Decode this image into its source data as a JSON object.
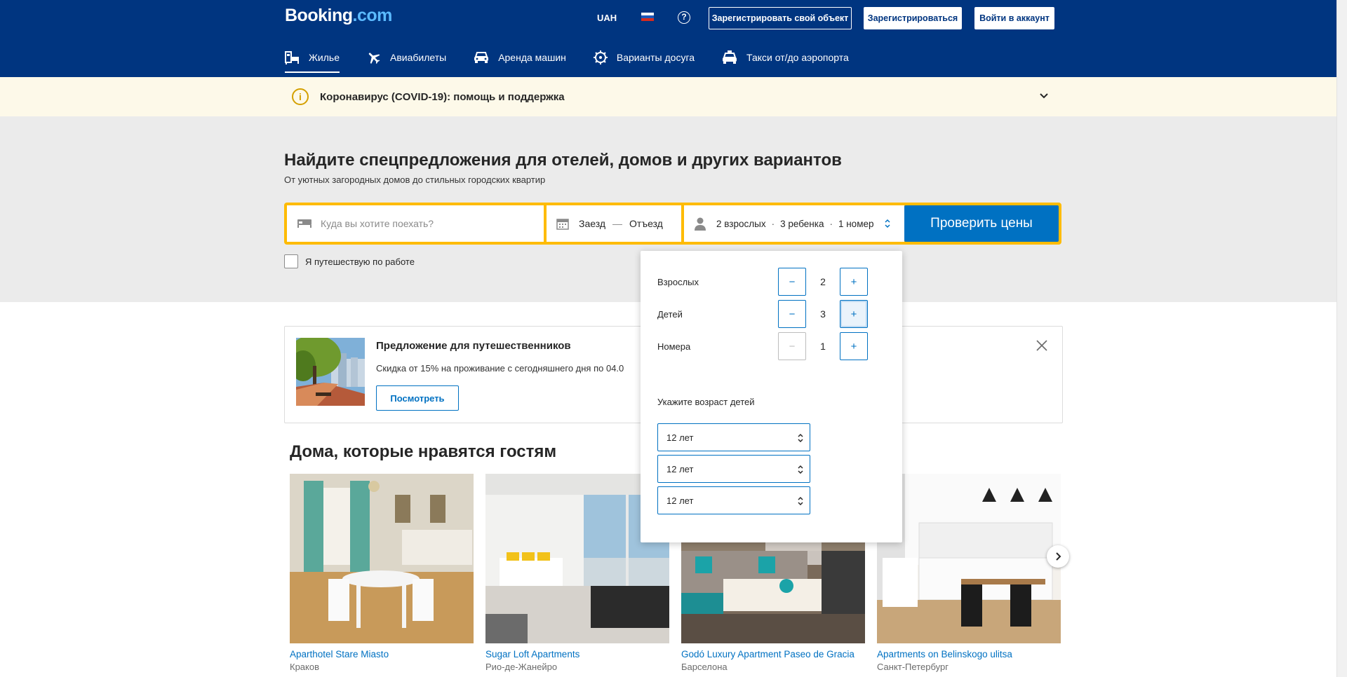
{
  "header": {
    "logo_main": "Booking",
    "logo_suffix": ".com",
    "currency": "UAH",
    "language_flag": "flag-ru-icon",
    "help_icon": "?",
    "list_property_label": "Зарегистрировать свой объект",
    "register_label": "Зарегистрироваться",
    "login_label": "Войти в аккаунт",
    "colors": {
      "brand_blue": "#003580",
      "accent_blue": "#0071c2",
      "search_yellow": "#febb02"
    }
  },
  "nav": {
    "items": [
      {
        "label": "Жилье",
        "icon": "bed-icon",
        "active": true
      },
      {
        "label": "Авиабилеты",
        "icon": "plane-icon",
        "active": false
      },
      {
        "label": "Аренда машин",
        "icon": "car-icon",
        "active": false
      },
      {
        "label": "Варианты досуга",
        "icon": "attractions-icon",
        "active": false
      },
      {
        "label": "Такси от/до аэропорта",
        "icon": "taxi-icon",
        "active": false
      }
    ]
  },
  "covid": {
    "icon": "info-icon",
    "text": "Коронавирус (COVID-19): помощь и поддержка"
  },
  "hero": {
    "title": "Найдите спецпредложения для отелей, домов и других вариантов",
    "subtitle": "От уютных загородных домов до стильных городских квартир"
  },
  "search": {
    "destination_placeholder": "Куда вы хотите поехать?",
    "checkin_label": "Заезд",
    "date_separator": "—",
    "checkout_label": "Отъезд",
    "guests_adults": "2 взрослых",
    "guests_children": "3 ребенка",
    "guests_rooms": "1 номер",
    "guests_dot": "·",
    "submit_label": "Проверить цены",
    "work_travel_label": "Я путешествую по работе"
  },
  "guests_popup": {
    "adults_label": "Взрослых",
    "adults_value": "2",
    "children_label": "Детей",
    "children_value": "3",
    "rooms_label": "Номера",
    "rooms_value": "1",
    "minus": "−",
    "plus": "+",
    "ages_label": "Укажите возраст детей",
    "child_ages": [
      "12 лет",
      "12 лет",
      "12 лет"
    ]
  },
  "promo": {
    "title": "Предложение для путешественников",
    "text": "Скидка от 15% на проживание с сегодняшнего дня по 04.0",
    "button_label": "Посмотреть"
  },
  "homes": {
    "section_title": "Дома, которые нравятся гостям",
    "cards": [
      {
        "name": "Aparthotel Stare Miasto",
        "city": "Краков"
      },
      {
        "name": "Sugar Loft Apartments",
        "city": "Рио-де-Жанейро"
      },
      {
        "name": "Godó Luxury Apartment Paseo de Gracia",
        "city": "Барселона"
      },
      {
        "name": "Apartments on Belinskogo ulitsa",
        "city": "Санкт-Петербург"
      }
    ]
  }
}
